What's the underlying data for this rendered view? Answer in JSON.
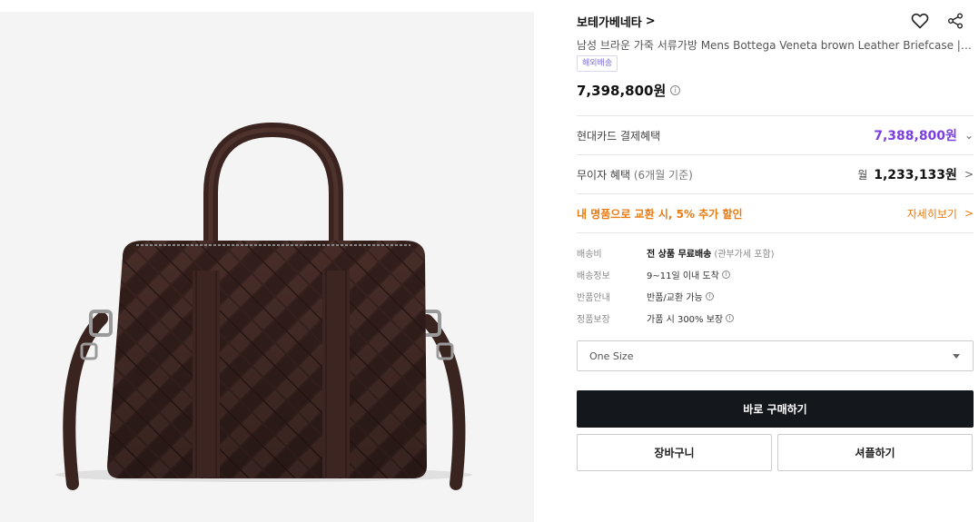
{
  "product": {
    "brand": "보테가베네타",
    "title": "남성 브라운 가죽 서류가방 Mens Bottega Veneta brown Leather Briefcase | H...",
    "badge": "해외배송",
    "price": "7,398,800원"
  },
  "benefits": {
    "card_label": "현대카드 결제혜택",
    "card_price": "7,388,800원",
    "installment_label": "무이자 혜택",
    "installment_note": "(6개월 기준)",
    "installment_unit": "월",
    "installment_price": "1,233,133원",
    "trade_text": "내 명품으로 교환 시, 5% 추가 할인",
    "trade_link": "자세히보기"
  },
  "shipping": {
    "rows": [
      {
        "label": "배송비",
        "value_bold": "전 상품 무료배송",
        "value_extra": "(관부가세 포함)"
      },
      {
        "label": "배송정보",
        "value": "9~11일 이내 도착"
      },
      {
        "label": "반품안내",
        "value": "반품/교환 가능"
      },
      {
        "label": "정품보장",
        "value": "가품 시 300% 보장"
      }
    ]
  },
  "option": {
    "selected": "One Size"
  },
  "actions": {
    "buy": "바로 구매하기",
    "cart": "장바구니",
    "sample": "셔플하기"
  },
  "icons": {
    "heart": "heart-icon",
    "share": "share-icon",
    "info": "info-icon",
    "chevron": "chevron-right-icon",
    "caret": "caret-down-icon"
  },
  "colors": {
    "accent_purple": "#7a3fe0",
    "accent_orange": "#e87b12",
    "buy_button": "#14181c",
    "bag_leather": "#3e2622"
  }
}
